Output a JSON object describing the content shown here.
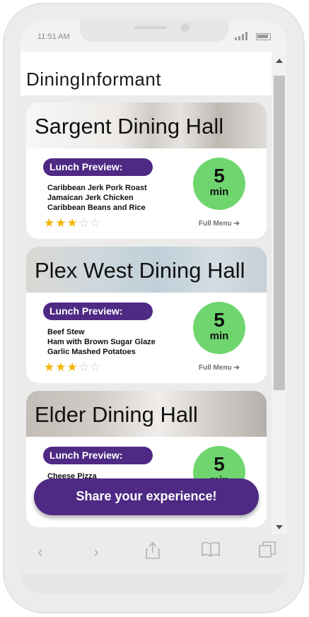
{
  "status_bar": {
    "time": "11:51 AM"
  },
  "app": {
    "title": "DiningInformant"
  },
  "halls": [
    {
      "name": "Sargent Dining Hall",
      "preview_label": "Lunch Preview:",
      "dishes": [
        "Caribbean Jerk Pork Roast",
        "Jamaican Jerk Chicken",
        "Caribbean Beans and Rice"
      ],
      "wait_value": "5",
      "wait_unit": "min",
      "rating": 3,
      "rating_max": 5,
      "full_menu_label": "Full Menu"
    },
    {
      "name": "Plex West Dining Hall",
      "preview_label": "Lunch Preview:",
      "dishes": [
        "Beef Stew",
        "Ham with Brown Sugar Glaze",
        "Garlic Mashed Potatoes"
      ],
      "wait_value": "5",
      "wait_unit": "min",
      "rating": 3,
      "rating_max": 5,
      "full_menu_label": "Full Menu"
    },
    {
      "name": "Elder Dining Hall",
      "preview_label": "Lunch Preview:",
      "dishes": [
        "Cheese Pizza"
      ],
      "wait_value": "5",
      "wait_unit": "min"
    }
  ],
  "share_button": {
    "label": "Share your experience!"
  },
  "toolbar": {
    "icons": [
      "back-icon",
      "forward-icon",
      "share-icon",
      "bookmarks-icon",
      "tabs-icon"
    ]
  },
  "colors": {
    "accent_purple": "#4e2a84",
    "wait_green": "#6fd66f",
    "star_gold": "#f4b400"
  }
}
